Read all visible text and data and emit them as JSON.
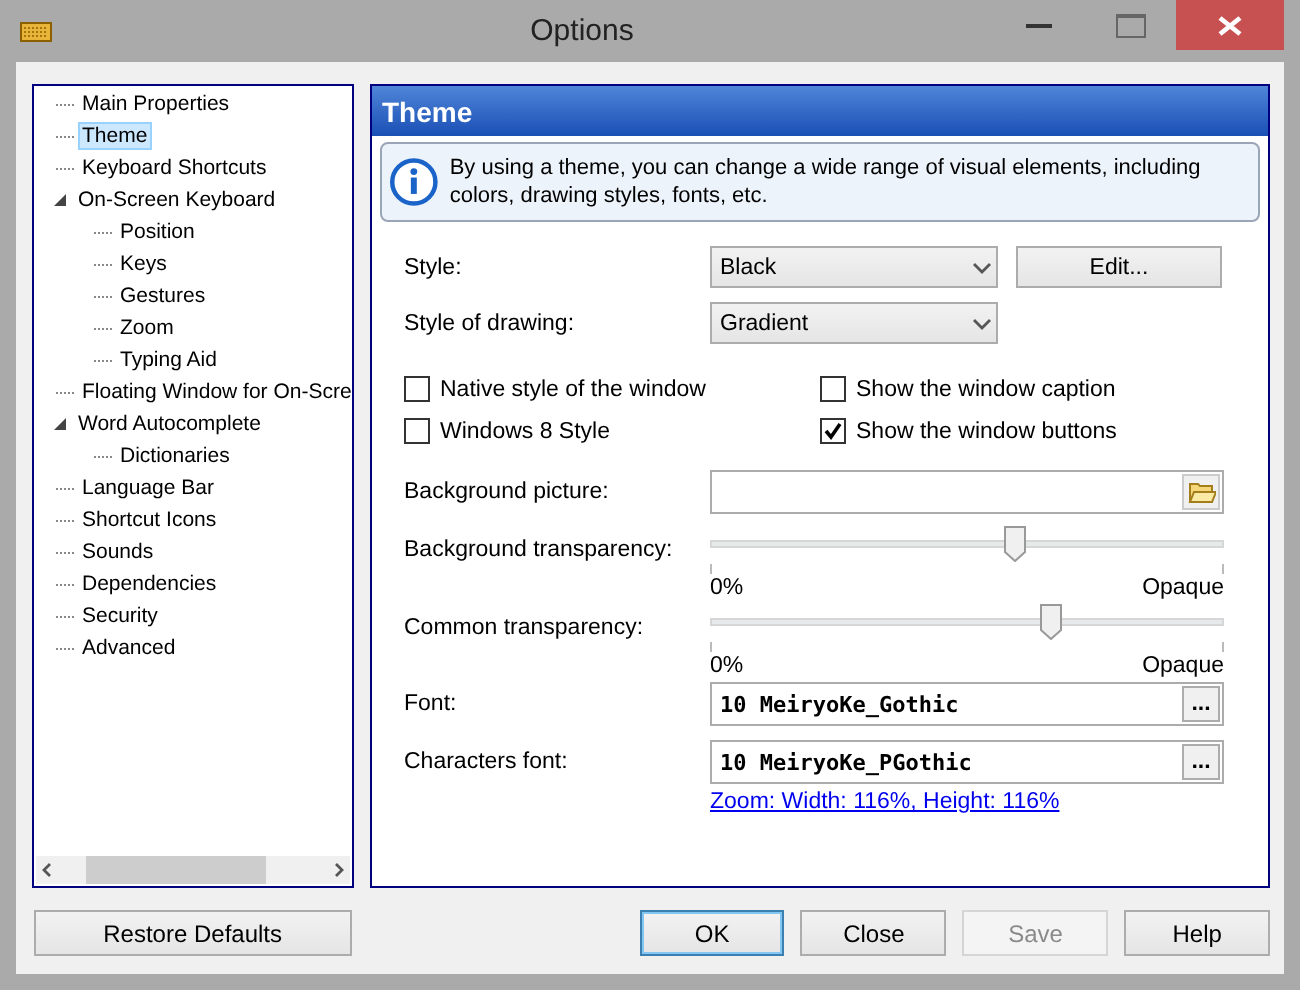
{
  "window": {
    "title": "Options"
  },
  "tree": [
    {
      "label": "Main Properties",
      "selected": false
    },
    {
      "label": "Theme",
      "selected": true
    },
    {
      "label": "Keyboard Shortcuts",
      "selected": false
    },
    {
      "label": "On-Screen Keyboard",
      "selected": false,
      "expanded": true,
      "children": [
        {
          "label": "Position",
          "selected": false
        },
        {
          "label": "Keys",
          "selected": false
        },
        {
          "label": "Gestures",
          "selected": false
        },
        {
          "label": "Zoom",
          "selected": false
        },
        {
          "label": "Typing Aid",
          "selected": false
        }
      ]
    },
    {
      "label": "Floating Window for On-Scre",
      "selected": false
    },
    {
      "label": "Word Autocomplete",
      "selected": false,
      "expanded": true,
      "children": [
        {
          "label": "Dictionaries",
          "selected": false
        }
      ]
    },
    {
      "label": "Language Bar",
      "selected": false
    },
    {
      "label": "Shortcut Icons",
      "selected": false
    },
    {
      "label": "Sounds",
      "selected": false
    },
    {
      "label": "Dependencies",
      "selected": false
    },
    {
      "label": "Security",
      "selected": false
    },
    {
      "label": "Advanced",
      "selected": false
    }
  ],
  "panel": {
    "title": "Theme",
    "info": "By using a theme, you can change a wide range of visual elements, including colors, drawing styles, fonts, etc.",
    "style": {
      "label": "Style:",
      "value": "Black",
      "edit_button": "Edit..."
    },
    "drawing": {
      "label": "Style of drawing:",
      "value": "Gradient"
    },
    "checkboxes": [
      {
        "label": "Native style of the window",
        "checked": false
      },
      {
        "label": "Show the window caption",
        "checked": false
      },
      {
        "label": "Windows 8 Style",
        "checked": false
      },
      {
        "label": "Show the window buttons",
        "checked": true
      }
    ],
    "background_picture": {
      "label": "Background picture:"
    },
    "sliders": [
      {
        "label": "Background transparency:",
        "level": 0.59,
        "min_label": "0%",
        "max_label": "Opaque"
      },
      {
        "label": "Common transparency:",
        "level": 0.66,
        "min_label": "0%",
        "max_label": "Opaque"
      }
    ],
    "fonts": [
      {
        "label": "Font:",
        "value": "10 MeiryoKe_Gothic",
        "button": "..."
      },
      {
        "label": "Characters font:",
        "value": "10 MeiryoKe_PGothic",
        "button": "..."
      }
    ],
    "zoom_link": "Zoom: Width: 116%, Height: 116%"
  },
  "buttons": [
    {
      "label": "Restore Defaults",
      "disabled": false
    },
    {
      "label": "OK",
      "disabled": false,
      "default": true
    },
    {
      "label": "Close",
      "disabled": false
    },
    {
      "label": "Save",
      "disabled": true
    },
    {
      "label": "Help",
      "disabled": false
    }
  ]
}
